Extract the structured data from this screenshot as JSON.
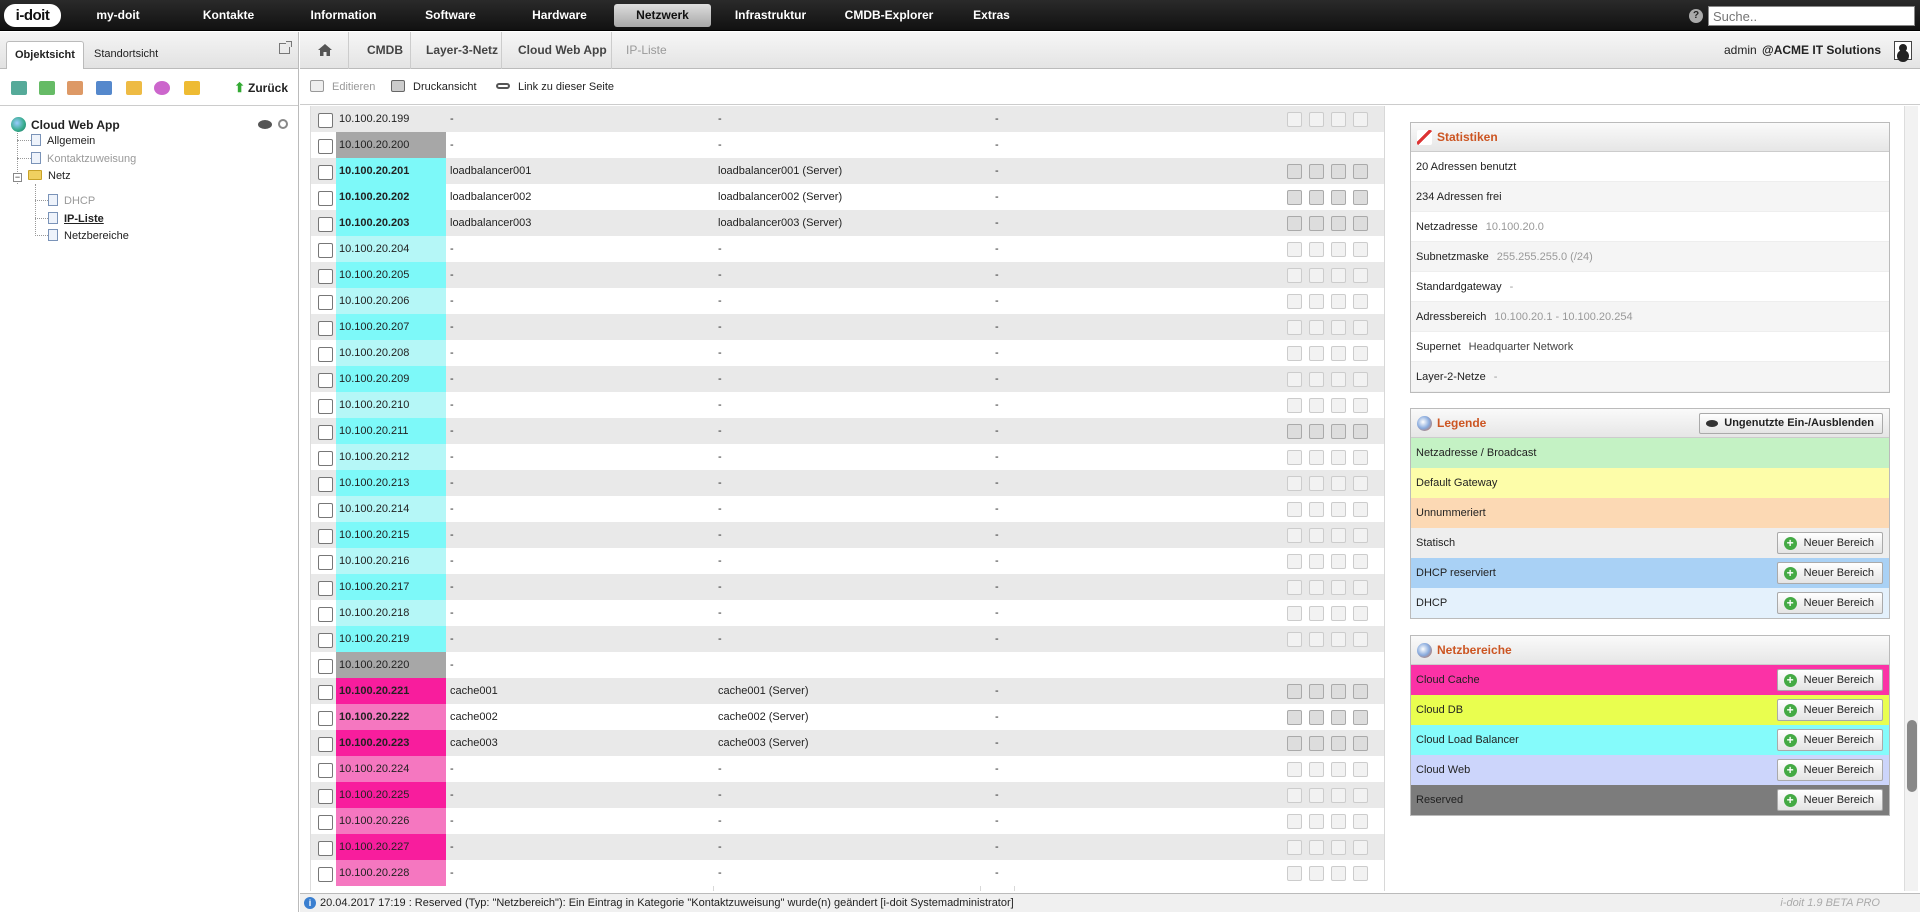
{
  "app": {
    "logo": "i-doit",
    "nav": [
      "my-doit",
      "Kontakte",
      "Information",
      "Software",
      "Hardware",
      "Netzwerk",
      "Infrastruktur",
      "CMDB-Explorer",
      "Extras"
    ],
    "active_nav": "Netzwerk",
    "search_placeholder": "Suche..",
    "help_icon": "question-icon"
  },
  "left": {
    "tabs": [
      "Objektsicht",
      "Standortsicht"
    ],
    "back_label": "Zurück",
    "tree": {
      "root": "Cloud Web App",
      "items": [
        "Allgemein",
        "Kontaktzuweisung",
        "Netz",
        "DHCP",
        "IP-Liste",
        "Netzbereiche"
      ]
    }
  },
  "breadcrumb": [
    "CMDB",
    "Layer-3-Netz",
    "Cloud Web App",
    "IP-Liste"
  ],
  "user": {
    "name": "admin",
    "tenant": "@ACME IT Solutions"
  },
  "actions": {
    "edit": "Editieren",
    "print": "Druckansicht",
    "link": "Link zu dieser Seite"
  },
  "colors": {
    "broadcast": "#a7a7a7",
    "load_balancer": "#7df9f9",
    "load_balancer_light": "#b5f7f7",
    "cache": "#f81d9d",
    "cache_light": "#f577c0",
    "legend_netzadresse": "#c4f2c4",
    "legend_gateway": "#fdfda9",
    "legend_unnummeriert": "#fcd9b4",
    "legend_statisch": "#eeeeee",
    "legend_dhcp_reserviert": "#a9d1f5",
    "legend_dhcp": "#e4f1fc",
    "nb_cloud_cache": "#fb32a6",
    "nb_cloud_db": "#e9fe4f",
    "nb_cloud_lb": "#85fbfb",
    "nb_cloud_web": "#ccd5fb",
    "nb_reserved": "#7c7c7c"
  },
  "ip_rows": [
    {
      "ip": "10.100.20.199",
      "hostname": "-",
      "object": "-",
      "extra": "-",
      "color": "",
      "bold": false,
      "active": false
    },
    {
      "ip": "10.100.20.200",
      "hostname": "-",
      "object": "-",
      "extra": "-",
      "color": "broadcast",
      "bold": false,
      "active": false
    },
    {
      "ip": "10.100.20.201",
      "hostname": "loadbalancer001",
      "object": "loadbalancer001 (Server)",
      "extra": "-",
      "color": "load_balancer",
      "bold": true,
      "active": true
    },
    {
      "ip": "10.100.20.202",
      "hostname": "loadbalancer002",
      "object": "loadbalancer002 (Server)",
      "extra": "-",
      "color": "load_balancer",
      "bold": true,
      "active": true
    },
    {
      "ip": "10.100.20.203",
      "hostname": "loadbalancer003",
      "object": "loadbalancer003 (Server)",
      "extra": "-",
      "color": "load_balancer",
      "bold": true,
      "active": true
    },
    {
      "ip": "10.100.20.204",
      "hostname": "-",
      "object": "-",
      "extra": "-",
      "color": "load_balancer_light",
      "bold": false,
      "active": false
    },
    {
      "ip": "10.100.20.205",
      "hostname": "-",
      "object": "-",
      "extra": "-",
      "color": "load_balancer",
      "bold": false,
      "active": false
    },
    {
      "ip": "10.100.20.206",
      "hostname": "-",
      "object": "-",
      "extra": "-",
      "color": "load_balancer_light",
      "bold": false,
      "active": false
    },
    {
      "ip": "10.100.20.207",
      "hostname": "-",
      "object": "-",
      "extra": "-",
      "color": "load_balancer",
      "bold": false,
      "active": false
    },
    {
      "ip": "10.100.20.208",
      "hostname": "-",
      "object": "-",
      "extra": "-",
      "color": "load_balancer_light",
      "bold": false,
      "active": false
    },
    {
      "ip": "10.100.20.209",
      "hostname": "-",
      "object": "-",
      "extra": "-",
      "color": "load_balancer",
      "bold": false,
      "active": false
    },
    {
      "ip": "10.100.20.210",
      "hostname": "-",
      "object": "-",
      "extra": "-",
      "color": "load_balancer_light",
      "bold": false,
      "active": false
    },
    {
      "ip": "10.100.20.211",
      "hostname": "-",
      "object": "-",
      "extra": "-",
      "color": "load_balancer",
      "bold": false,
      "active": true
    },
    {
      "ip": "10.100.20.212",
      "hostname": "-",
      "object": "-",
      "extra": "-",
      "color": "load_balancer_light",
      "bold": false,
      "active": false
    },
    {
      "ip": "10.100.20.213",
      "hostname": "-",
      "object": "-",
      "extra": "-",
      "color": "load_balancer",
      "bold": false,
      "active": false
    },
    {
      "ip": "10.100.20.214",
      "hostname": "-",
      "object": "-",
      "extra": "-",
      "color": "load_balancer_light",
      "bold": false,
      "active": false
    },
    {
      "ip": "10.100.20.215",
      "hostname": "-",
      "object": "-",
      "extra": "-",
      "color": "load_balancer",
      "bold": false,
      "active": false
    },
    {
      "ip": "10.100.20.216",
      "hostname": "-",
      "object": "-",
      "extra": "-",
      "color": "load_balancer_light",
      "bold": false,
      "active": false
    },
    {
      "ip": "10.100.20.217",
      "hostname": "-",
      "object": "-",
      "extra": "-",
      "color": "load_balancer",
      "bold": false,
      "active": false
    },
    {
      "ip": "10.100.20.218",
      "hostname": "-",
      "object": "-",
      "extra": "-",
      "color": "load_balancer_light",
      "bold": false,
      "active": false
    },
    {
      "ip": "10.100.20.219",
      "hostname": "-",
      "object": "-",
      "extra": "-",
      "color": "load_balancer",
      "bold": false,
      "active": false
    },
    {
      "ip": "10.100.20.220",
      "hostname": "-",
      "object": "",
      "extra": "",
      "color": "broadcast",
      "bold": false,
      "active": false
    },
    {
      "ip": "10.100.20.221",
      "hostname": "cache001",
      "object": "cache001 (Server)",
      "extra": "-",
      "color": "cache",
      "bold": true,
      "active": true
    },
    {
      "ip": "10.100.20.222",
      "hostname": "cache002",
      "object": "cache002 (Server)",
      "extra": "-",
      "color": "cache_light",
      "bold": true,
      "active": true
    },
    {
      "ip": "10.100.20.223",
      "hostname": "cache003",
      "object": "cache003 (Server)",
      "extra": "-",
      "color": "cache",
      "bold": true,
      "active": true
    },
    {
      "ip": "10.100.20.224",
      "hostname": "-",
      "object": "-",
      "extra": "-",
      "color": "cache_light",
      "bold": false,
      "active": false
    },
    {
      "ip": "10.100.20.225",
      "hostname": "-",
      "object": "-",
      "extra": "-",
      "color": "cache",
      "bold": false,
      "active": false
    },
    {
      "ip": "10.100.20.226",
      "hostname": "-",
      "object": "-",
      "extra": "-",
      "color": "cache_light",
      "bold": false,
      "active": false
    },
    {
      "ip": "10.100.20.227",
      "hostname": "-",
      "object": "-",
      "extra": "-",
      "color": "cache",
      "bold": false,
      "active": false
    },
    {
      "ip": "10.100.20.228",
      "hostname": "-",
      "object": "-",
      "extra": "-",
      "color": "cache_light",
      "bold": false,
      "active": false
    }
  ],
  "stats": {
    "title": "Statistiken",
    "rows": [
      {
        "label": "20 Adressen benutzt",
        "value": ""
      },
      {
        "label": "234 Adressen frei",
        "value": ""
      },
      {
        "label": "Netzadresse",
        "value": "10.100.20.0"
      },
      {
        "label": "Subnetzmaske",
        "value": "255.255.255.0 (/24)"
      },
      {
        "label": "Standardgateway",
        "value": "-"
      },
      {
        "label": "Adressbereich",
        "value": "10.100.20.1 - 10.100.20.254"
      },
      {
        "label": "Supernet",
        "value": "Headquarter Network"
      },
      {
        "label": "Layer-2-Netze",
        "value": "-"
      }
    ]
  },
  "legend": {
    "title": "Legende",
    "toggle_label": "Ungenutzte Ein-/Ausblenden",
    "rows": [
      {
        "label": "Netzadresse / Broadcast",
        "color": "legend_netzadresse",
        "button": ""
      },
      {
        "label": "Default Gateway",
        "color": "legend_gateway",
        "button": ""
      },
      {
        "label": "Unnummeriert",
        "color": "legend_unnummeriert",
        "button": ""
      },
      {
        "label": "Statisch",
        "color": "legend_statisch",
        "button": "Neuer Bereich"
      },
      {
        "label": "DHCP reserviert",
        "color": "legend_dhcp_reserviert",
        "button": "Neuer Bereich"
      },
      {
        "label": "DHCP",
        "color": "legend_dhcp",
        "button": "Neuer Bereich"
      }
    ]
  },
  "netzbereiche": {
    "title": "Netzbereiche",
    "rows": [
      {
        "label": "Cloud Cache",
        "color": "nb_cloud_cache",
        "button": "Neuer Bereich"
      },
      {
        "label": "Cloud DB",
        "color": "nb_cloud_db",
        "button": "Neuer Bereich"
      },
      {
        "label": "Cloud Load Balancer",
        "color": "nb_cloud_lb",
        "button": "Neuer Bereich"
      },
      {
        "label": "Cloud Web",
        "color": "nb_cloud_web",
        "button": "Neuer Bereich"
      },
      {
        "label": "Reserved",
        "color": "nb_reserved",
        "button": "Neuer Bereich"
      }
    ]
  },
  "status": {
    "message": "20.04.2017 17:19 : Reserved (Typ: \"Netzbereich\"): Ein Eintrag in Kategorie \"Kontaktzuweisung\" wurde(n) geändert [i-doit Systemadministrator]",
    "version": "i-doit 1.9 BETA PRO"
  }
}
